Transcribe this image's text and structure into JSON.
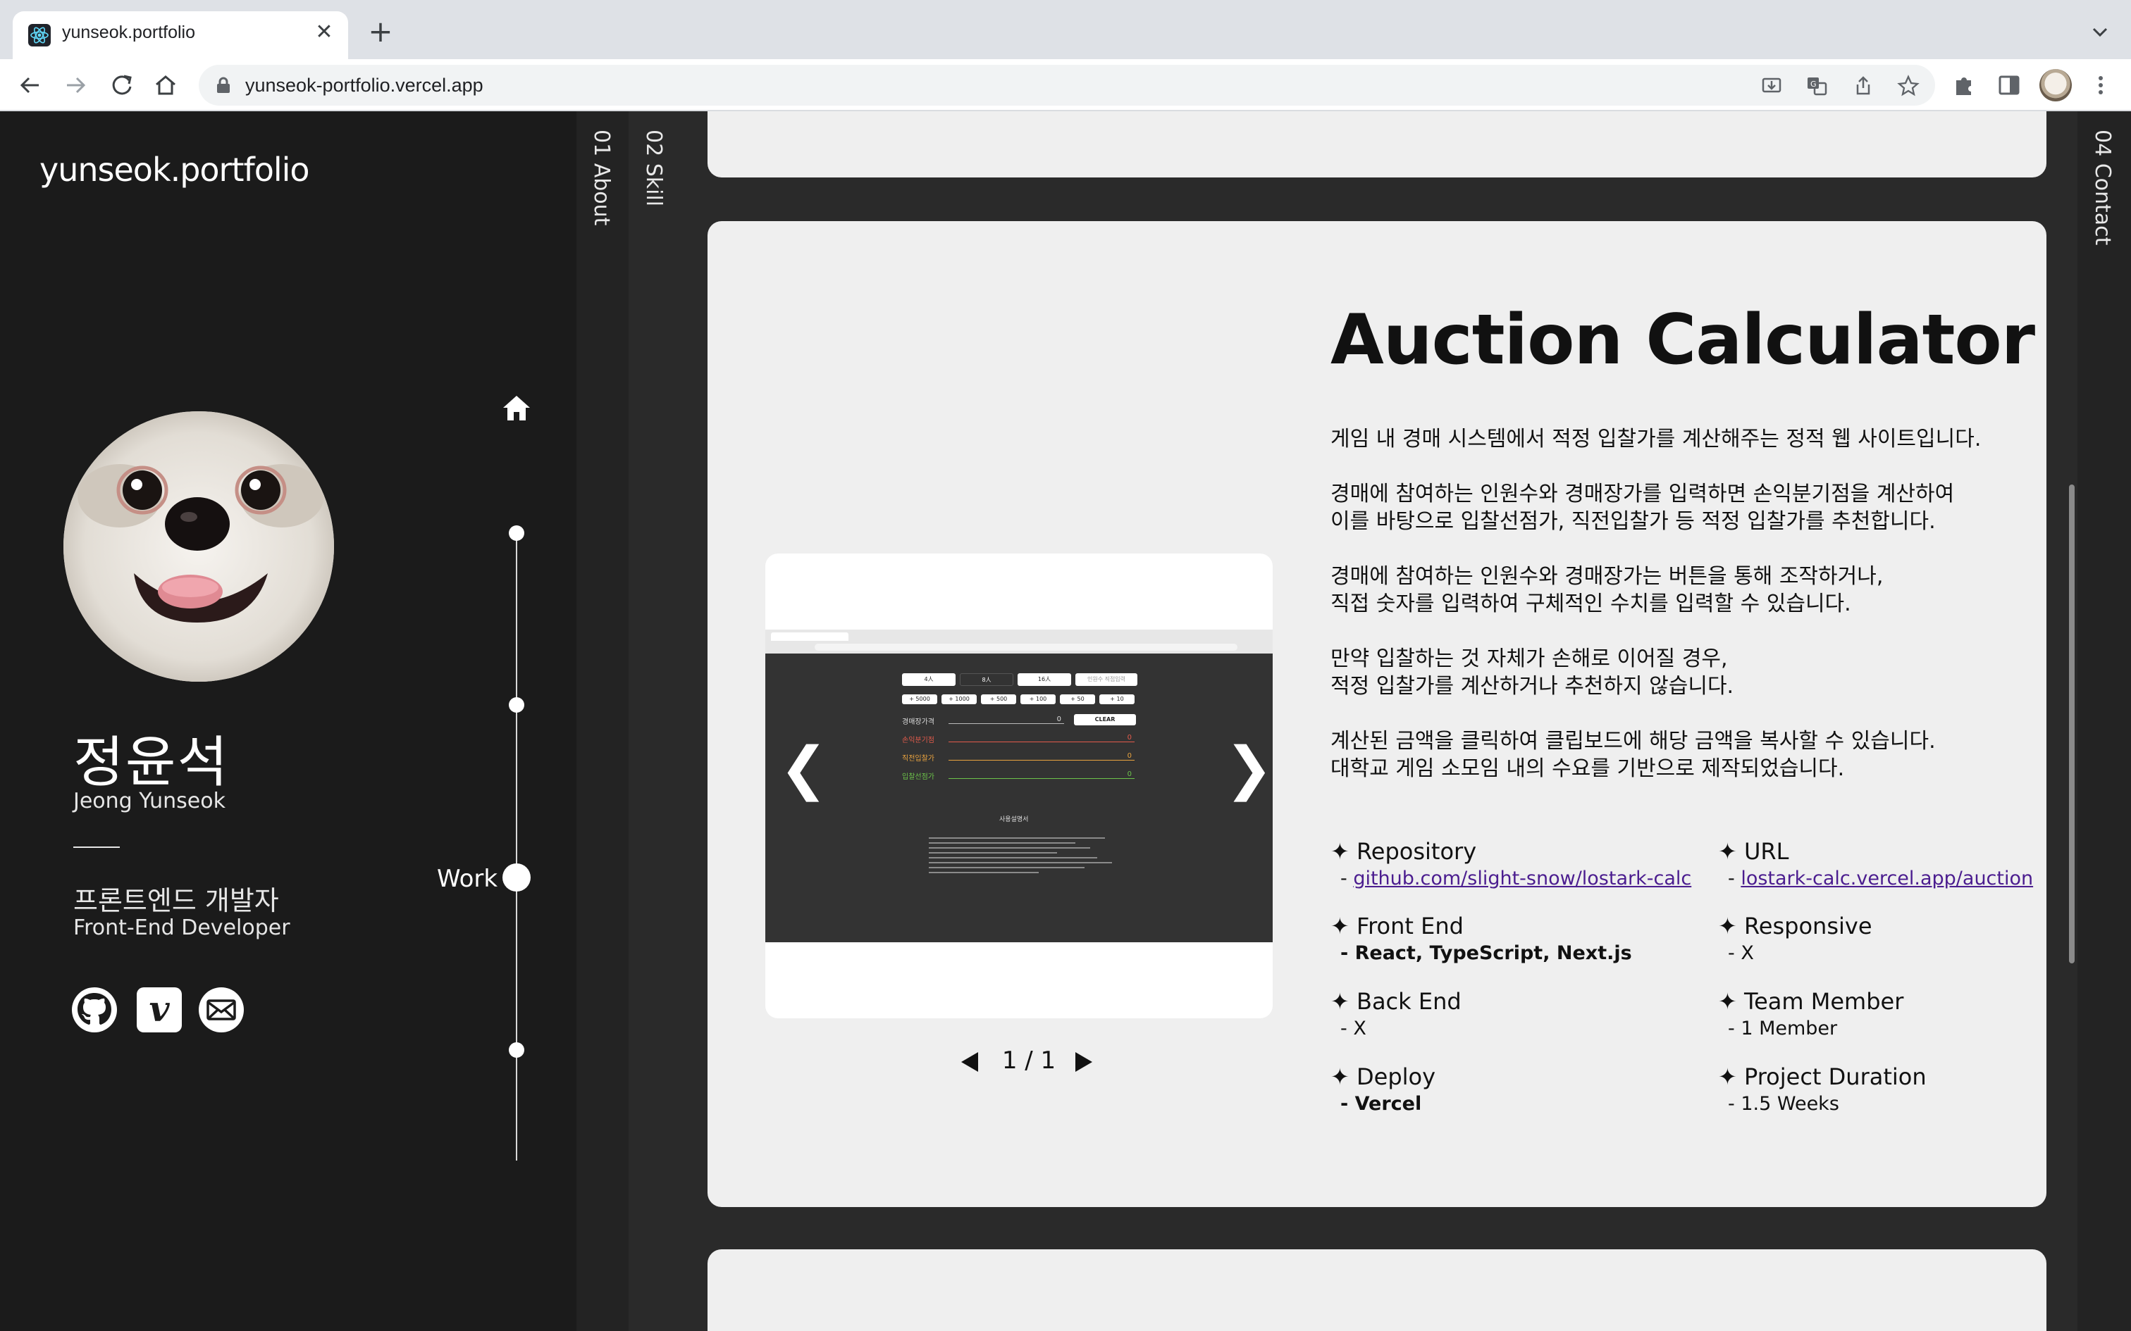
{
  "browser": {
    "tab_title": "yunseok.portfolio",
    "tab_close": "✕",
    "new_tab": "+",
    "url": "yunseok-portfolio.vercel.app"
  },
  "sidebar": {
    "logo": "yunseok.portfolio",
    "name_ko": "정윤석",
    "name_en": "Jeong Yunseok",
    "role_ko": "프론트엔드 개발자",
    "role_en": "Front-End Developer",
    "vimeo_glyph": "v",
    "timeline_label": "Work"
  },
  "nav": {
    "about": "01 About",
    "skill": "02 Skill",
    "contact": "04 Contact"
  },
  "project": {
    "title": "Auction Calculator",
    "description": [
      "게임 내 경매 시스템에서 적정 입찰가를 계산해주는 정적 웹 사이트입니다.",
      "경매에 참여하는 인원수와 경매장가를 입력하면 손익분기점을 계산하여\n이를 바탕으로 입찰선점가, 직전입찰가 등 적정 입찰가를 추천합니다.",
      "경매에 참여하는 인원수와 경매장가는 버튼을 통해 조작하거나,\n직접 숫자를 입력하여 구체적인 수치를 입력할 수 있습니다.",
      "만약 입찰하는 것 자체가 손해로 이어질 경우,\n적정 입찰가를 계산하거나 추천하지 않습니다.",
      "계산된 금액을 클릭하여 클립보드에 해당 금액을 복사할 수 있습니다.\n대학교 게임 소모임 내의 수요를 기반으로 제작되었습니다."
    ],
    "info": {
      "repository_label": "✦ Repository",
      "repository_value": "github.com/slight-snow/lostark-calc",
      "url_label": "✦ URL",
      "url_value": "lostark-calc.vercel.app/auction",
      "frontend_label": "✦ Front End",
      "frontend_value": "React, TypeScript, Next.js",
      "responsive_label": "✦ Responsive",
      "responsive_value": "X",
      "backend_label": "✦ Back End",
      "backend_value": "X",
      "team_label": "✦ Team Member",
      "team_value": "1 Member",
      "deploy_label": "✦ Deploy",
      "deploy_value": "Vercel",
      "duration_label": "✦ Project Duration",
      "duration_value": "1.5 Weeks"
    },
    "dash": "- ",
    "carousel": {
      "prev_glyph": "❮",
      "next_glyph": "❯",
      "page_current": "1",
      "page_sep": "/",
      "page_total": "1"
    }
  },
  "screenshot_preview": {
    "buttons_top": [
      "4人",
      "8人",
      "16人",
      "인원수 직접입력"
    ],
    "buttons_amount": [
      "+ 5000",
      "+ 1000",
      "+ 500",
      "+ 100",
      "+ 50",
      "+ 10"
    ],
    "price_label": "경매장가격",
    "price_value": "0",
    "clear_label": "CLEAR",
    "rows": [
      {
        "label": "손익분기점",
        "value": "0",
        "color": "#e25b4b"
      },
      {
        "label": "직전입찰가",
        "value": "0",
        "color": "#e9a33f"
      },
      {
        "label": "입찰선점가",
        "value": "0",
        "color": "#6cc24a"
      }
    ],
    "notes_title": "사용설명서"
  },
  "colors": {
    "page_bg": "#1b1b1b",
    "card_bg": "#efefef",
    "link": "#4b1d8f"
  },
  "icons": [
    "react-favicon-icon",
    "back-arrow-icon",
    "forward-arrow-icon",
    "reload-icon",
    "home-icon",
    "lock-icon",
    "install-icon",
    "translate-icon",
    "share-icon",
    "star-icon",
    "extensions-icon",
    "sidepanel-icon",
    "kebab-menu-icon",
    "github-icon",
    "vimeo-icon",
    "mail-icon",
    "chevron-down-icon"
  ]
}
